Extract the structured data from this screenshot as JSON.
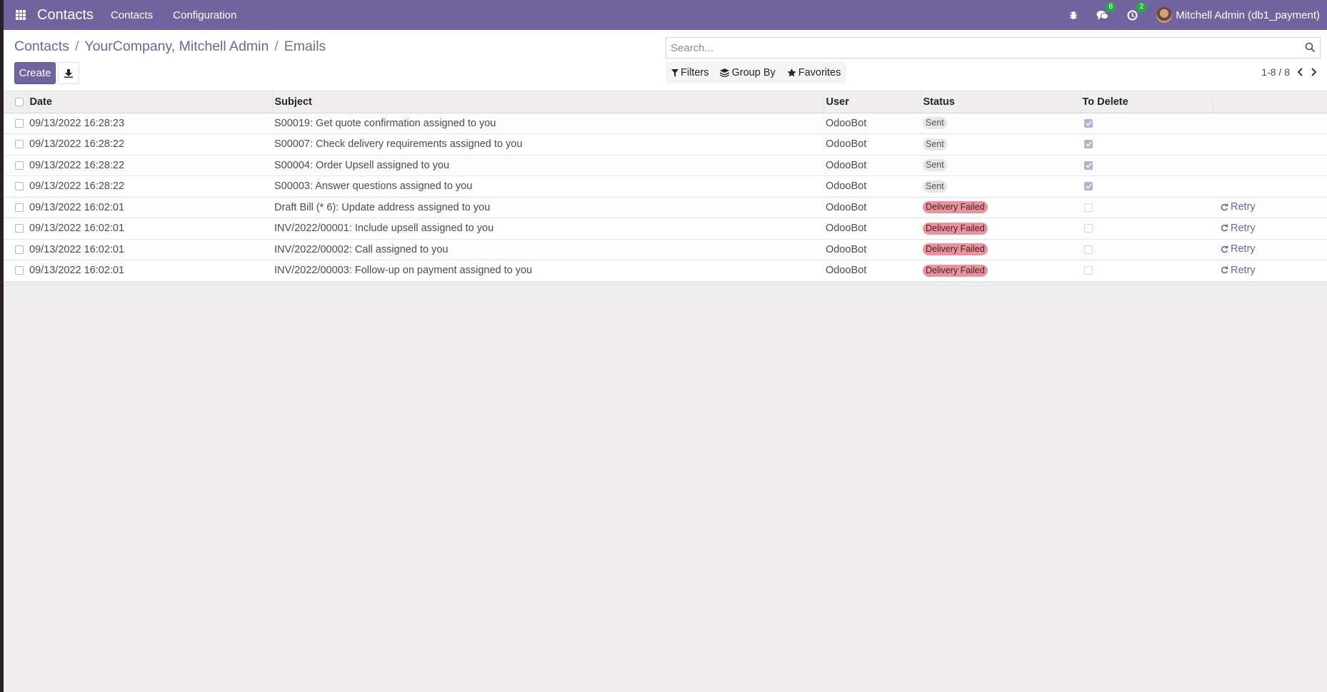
{
  "navbar": {
    "app_name": "Contacts",
    "menus": [
      "Contacts",
      "Configuration"
    ],
    "messages_count": "8",
    "activities_count": "2",
    "user": "Mitchell Admin (db1_payment)"
  },
  "breadcrumb": {
    "root": "Contacts",
    "record": "YourCompany, Mitchell Admin",
    "current": "Emails"
  },
  "actions": {
    "create_label": "Create"
  },
  "search": {
    "placeholder": "Search..."
  },
  "filters": {
    "filters_label": "Filters",
    "groupby_label": "Group By",
    "favorites_label": "Favorites"
  },
  "pager": {
    "value": "1-8 / 8"
  },
  "table": {
    "headers": {
      "date": "Date",
      "subject": "Subject",
      "user": "User",
      "status": "Status",
      "to_delete": "To Delete"
    },
    "retry_label": "Retry",
    "rows": [
      {
        "date": "09/13/2022 16:28:23",
        "subject": "S00019: Get quote confirmation assigned to you",
        "user": "OdooBot",
        "status": "Sent",
        "to_delete": true
      },
      {
        "date": "09/13/2022 16:28:22",
        "subject": "S00007: Check delivery requirements assigned to you",
        "user": "OdooBot",
        "status": "Sent",
        "to_delete": true
      },
      {
        "date": "09/13/2022 16:28:22",
        "subject": "S00004: Order Upsell assigned to you",
        "user": "OdooBot",
        "status": "Sent",
        "to_delete": true
      },
      {
        "date": "09/13/2022 16:28:22",
        "subject": "S00003: Answer questions assigned to you",
        "user": "OdooBot",
        "status": "Sent",
        "to_delete": true
      },
      {
        "date": "09/13/2022 16:02:01",
        "subject": "Draft Bill (* 6): Update address assigned to you",
        "user": "OdooBot",
        "status": "Delivery Failed",
        "to_delete": false
      },
      {
        "date": "09/13/2022 16:02:01",
        "subject": "INV/2022/00001: Include upsell assigned to you",
        "user": "OdooBot",
        "status": "Delivery Failed",
        "to_delete": false
      },
      {
        "date": "09/13/2022 16:02:01",
        "subject": "INV/2022/00002: Call assigned to you",
        "user": "OdooBot",
        "status": "Delivery Failed",
        "to_delete": false
      },
      {
        "date": "09/13/2022 16:02:01",
        "subject": "INV/2022/00003: Follow-up on payment assigned to you",
        "user": "OdooBot",
        "status": "Delivery Failed",
        "to_delete": false
      }
    ]
  },
  "colors": {
    "brand": "#71639e",
    "failed_badge": "#e8949d",
    "sent_badge": "#e6e6e6",
    "count_badge": "#28a745"
  }
}
